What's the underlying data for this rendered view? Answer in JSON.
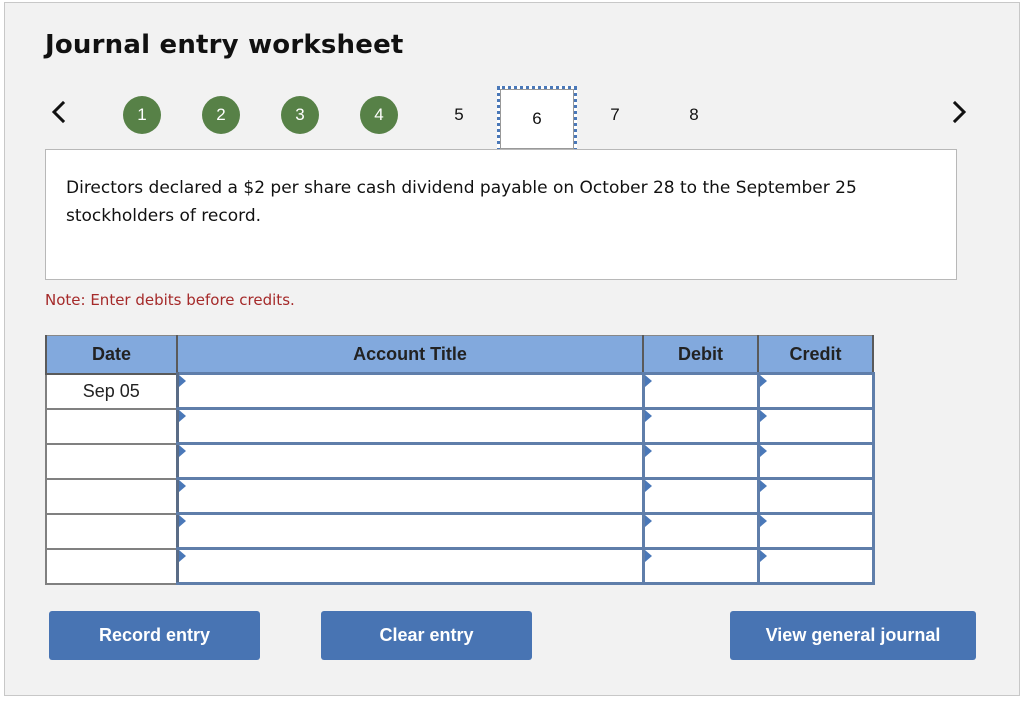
{
  "worksheet": {
    "title": "Journal entry worksheet",
    "nav": {
      "prev_icon": "chevron-left-icon",
      "next_icon": "chevron-right-icon"
    },
    "steps": [
      {
        "label": "1",
        "state": "completed"
      },
      {
        "label": "2",
        "state": "completed"
      },
      {
        "label": "3",
        "state": "completed"
      },
      {
        "label": "4",
        "state": "completed"
      },
      {
        "label": "5",
        "state": "pending"
      },
      {
        "label": "6",
        "state": "current"
      },
      {
        "label": "7",
        "state": "pending"
      },
      {
        "label": "8",
        "state": "pending"
      }
    ],
    "question": "Directors declared a $2 per share cash dividend payable on October 28 to the September 25 stockholders of record.",
    "note": "Note: Enter debits before credits.",
    "table": {
      "headers": {
        "date": "Date",
        "account": "Account Title",
        "debit": "Debit",
        "credit": "Credit"
      },
      "rows": [
        {
          "date": "Sep 05",
          "account": "",
          "debit": "",
          "credit": ""
        },
        {
          "date": "",
          "account": "",
          "debit": "",
          "credit": ""
        },
        {
          "date": "",
          "account": "",
          "debit": "",
          "credit": ""
        },
        {
          "date": "",
          "account": "",
          "debit": "",
          "credit": ""
        },
        {
          "date": "",
          "account": "",
          "debit": "",
          "credit": ""
        },
        {
          "date": "",
          "account": "",
          "debit": "",
          "credit": ""
        }
      ]
    },
    "buttons": {
      "record": "Record entry",
      "clear": "Clear entry",
      "view": "View general journal"
    },
    "colors": {
      "completed_step": "#578147",
      "header_bg": "#82a9dd",
      "button_bg": "#4874b3",
      "note_text": "#a52a2a",
      "focus_outline": "#4a78b8"
    }
  }
}
